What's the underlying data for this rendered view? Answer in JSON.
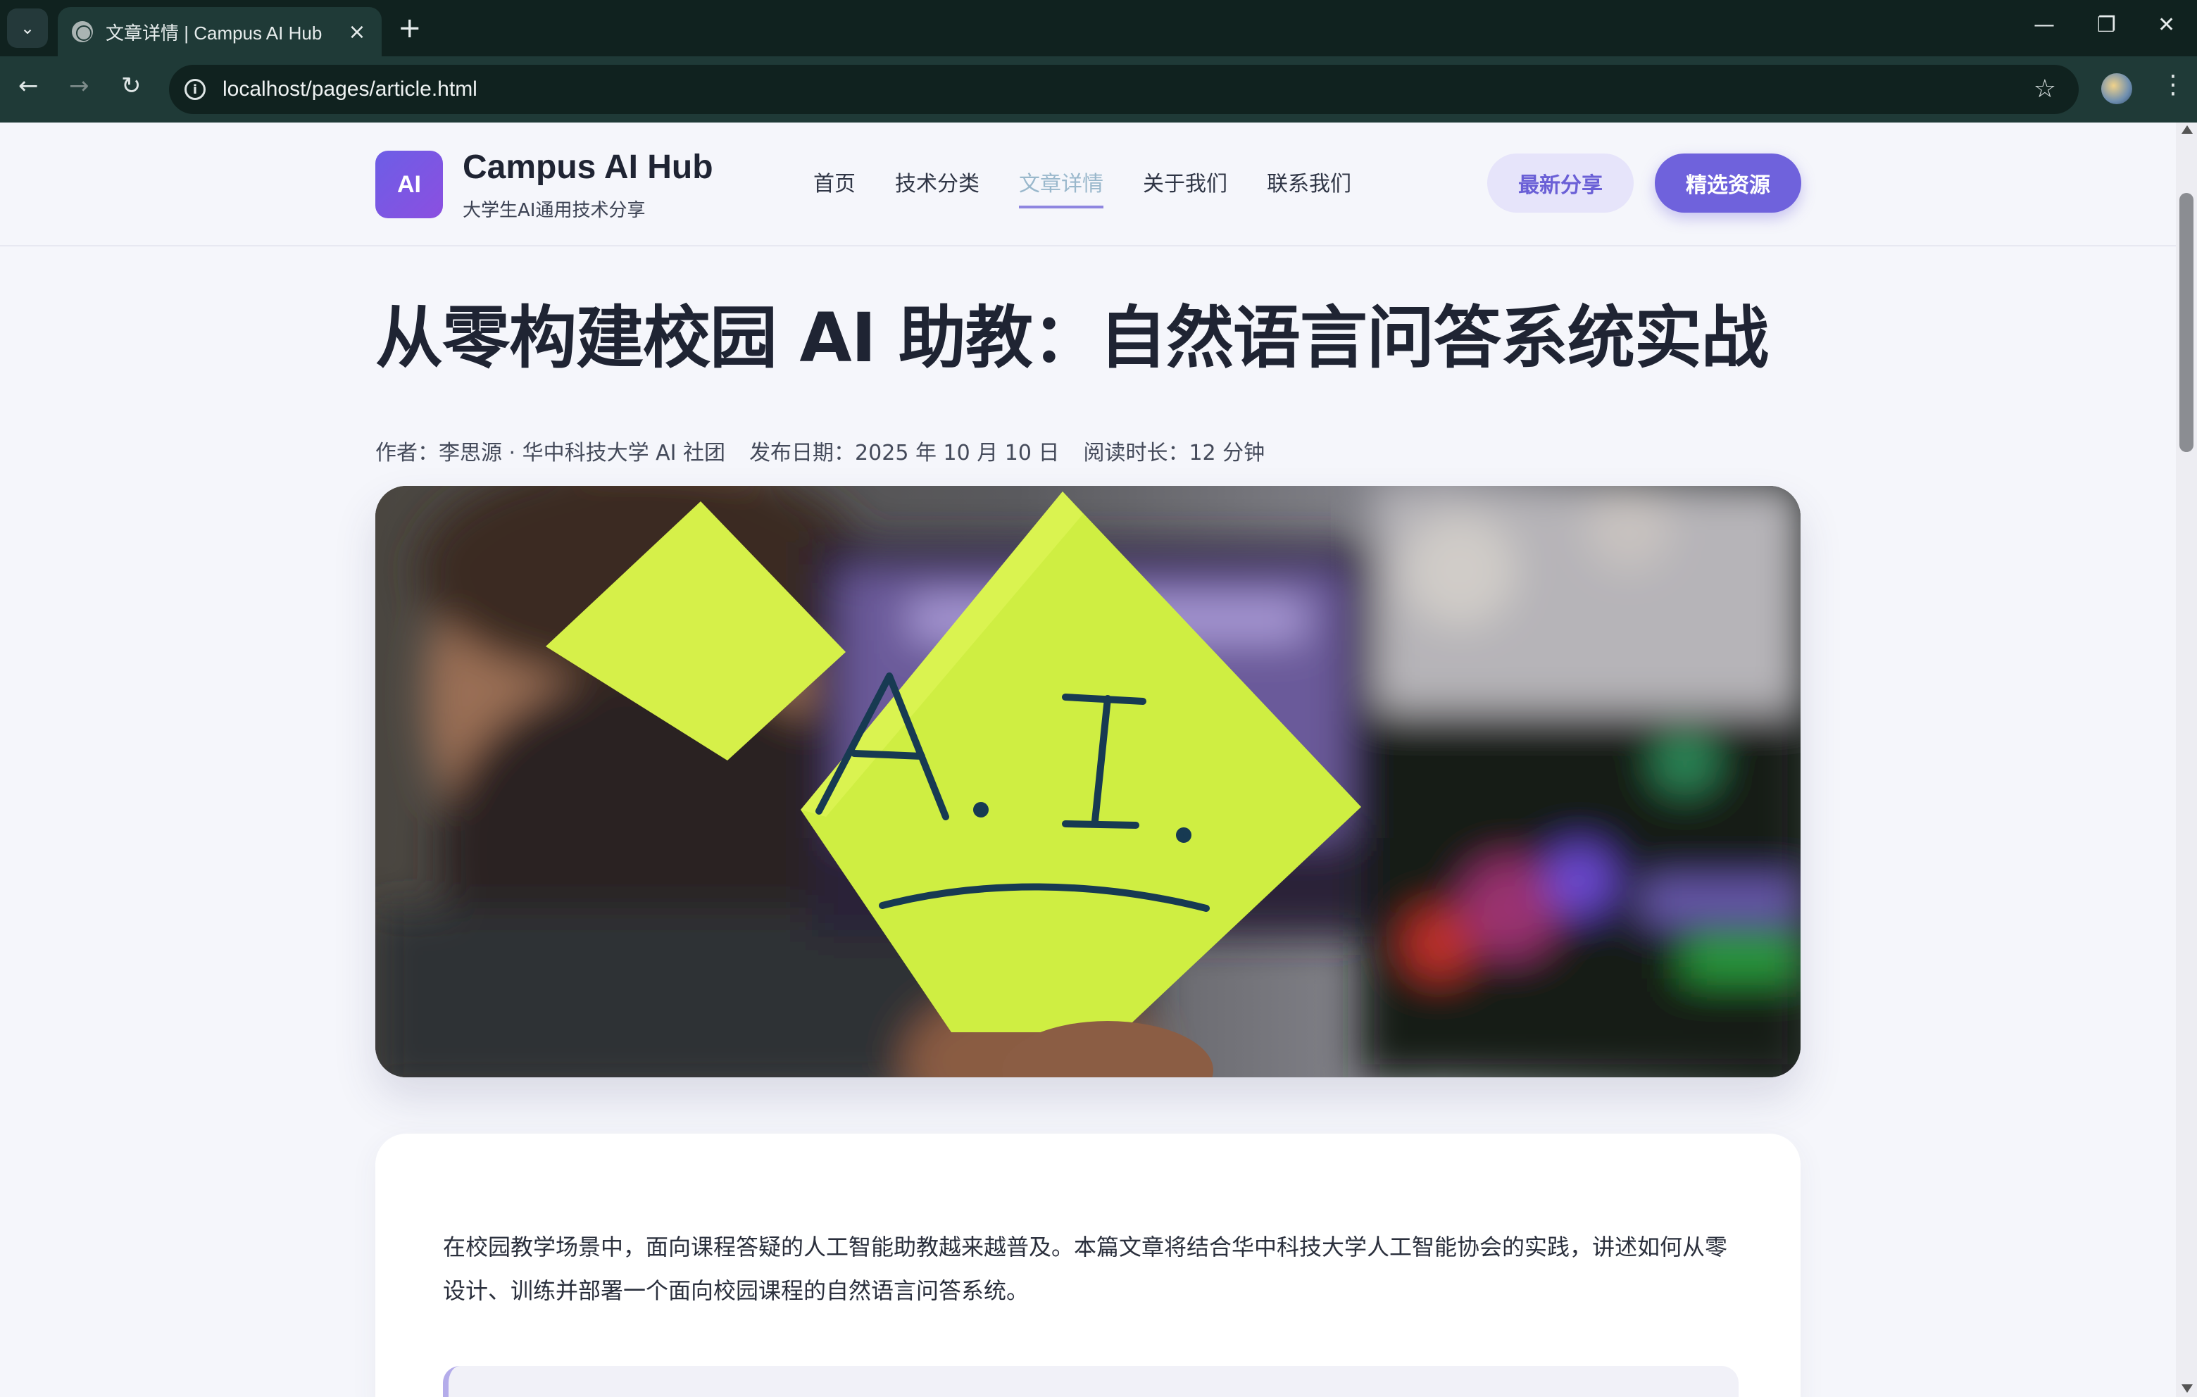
{
  "browser": {
    "tab_title": "文章详情 | Campus AI Hub",
    "url": "localhost/pages/article.html"
  },
  "header": {
    "logo_text": "AI",
    "brand_name": "Campus AI Hub",
    "brand_subtitle": "大学生AI通用技术分享",
    "nav": [
      "首页",
      "技术分类",
      "文章详情",
      "关于我们",
      "联系我们"
    ],
    "active_nav": "文章详情",
    "btn_latest": "最新分享",
    "btn_featured": "精选资源"
  },
  "article": {
    "title": "从零构建校园 AI 助教：自然语言问答系统实战",
    "author": "作者：李思源 · 华中科技大学 AI 社团",
    "date": "发布日期：2025 年 10 月 10 日",
    "read_time": "阅读时长：12 分钟",
    "hero_image_text": "A.I.",
    "intro": "在校园教学场景中，面向课程答疑的人工智能助教越来越普及。本篇文章将结合华中科技大学人工智能协会的实践，讲述如何从零设计、训练并部署一个面向校园课程的自然语言问答系统。"
  },
  "colors": {
    "accent": "#6f62dc",
    "accent_light": "#e6e4fa",
    "active_nav": "#9ab8cc",
    "sticky_note": "#d7f04a"
  }
}
